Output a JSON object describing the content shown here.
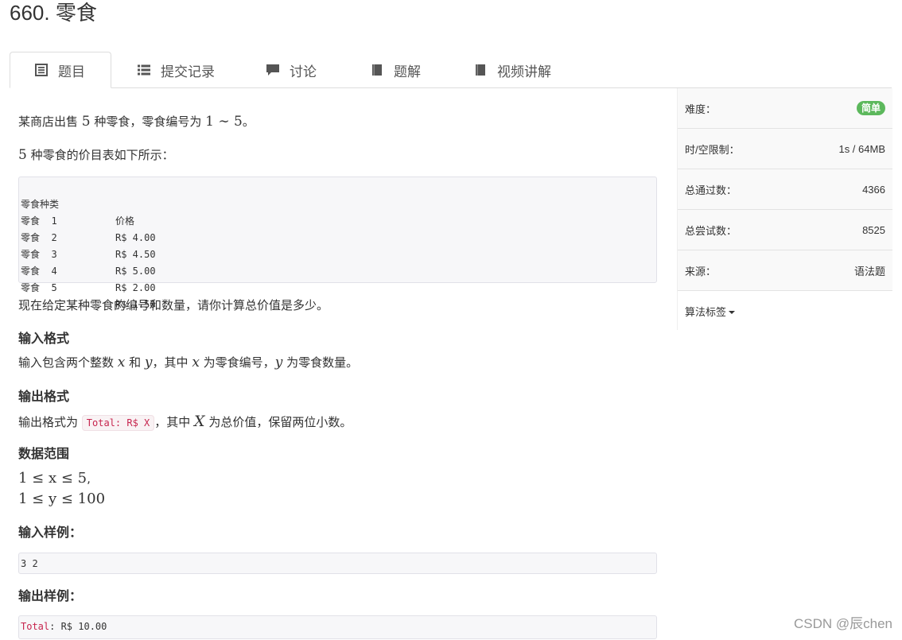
{
  "problem": {
    "title": "660. 零食"
  },
  "tabs": [
    {
      "label": "题目",
      "icon": "document-icon"
    },
    {
      "label": "提交记录",
      "icon": "list-icon"
    },
    {
      "label": "讨论",
      "icon": "comment-icon"
    },
    {
      "label": "题解",
      "icon": "book-icon"
    },
    {
      "label": "视频讲解",
      "icon": "book-icon"
    }
  ],
  "sidebar": {
    "difficulty_label": "难度：",
    "difficulty_value": "简单",
    "limit_label": "时/空限制：",
    "limit_value": "1s / 64MB",
    "passed_label": "总通过数：",
    "passed_value": "4366",
    "tried_label": "总尝试数：",
    "tried_value": "8525",
    "source_label": "来源：",
    "source_value": "语法题",
    "tags_label": "算法标签"
  },
  "content": {
    "intro_a": "某商店出售 ",
    "intro_n": "5",
    "intro_b": " 种零食，零食编号为 ",
    "intro_range": "1 ∼ 5",
    "intro_c": "。",
    "table_intro_n": "5",
    "table_intro": " 种零食的价目表如下所示：",
    "price_table": {
      "headers": [
        "零食种类",
        "价格"
      ],
      "rows": [
        [
          "零食  1",
          "R$ 4.00"
        ],
        [
          "零食  2",
          "R$ 4.50"
        ],
        [
          "零食  3",
          "R$ 5.00"
        ],
        [
          "零食  4",
          "R$ 2.00"
        ],
        [
          "零食  5",
          "R$ 1.50"
        ]
      ]
    },
    "task": "现在给定某种零食的编号和数量，请你计算总价值是多少。",
    "input_title": "输入格式",
    "input_a": "输入包含两个整数 ",
    "input_x": "x",
    "input_b": " 和 ",
    "input_y": "y",
    "input_c": "，其中 ",
    "input_x2": "x",
    "input_d": " 为零食编号，",
    "input_y2": "y",
    "input_e": " 为零食数量。",
    "output_title": "输出格式",
    "output_a": "输出格式为 ",
    "output_code": "Total: R$ X",
    "output_b": "，其中 ",
    "output_X": "X",
    "output_c": " 为总价值，保留两位小数。",
    "range_title": "数据范围",
    "range_1": "1 ≤ x ≤ 5",
    "range_1_tail": ",",
    "range_2": "1 ≤ y ≤ 100",
    "sample_in_title": "输入样例：",
    "sample_in": "3 2",
    "sample_out_title": "输出样例：",
    "sample_out_key": "Total",
    "sample_out_rest": ": R$ 10.00"
  },
  "watermark": "CSDN @辰chen"
}
